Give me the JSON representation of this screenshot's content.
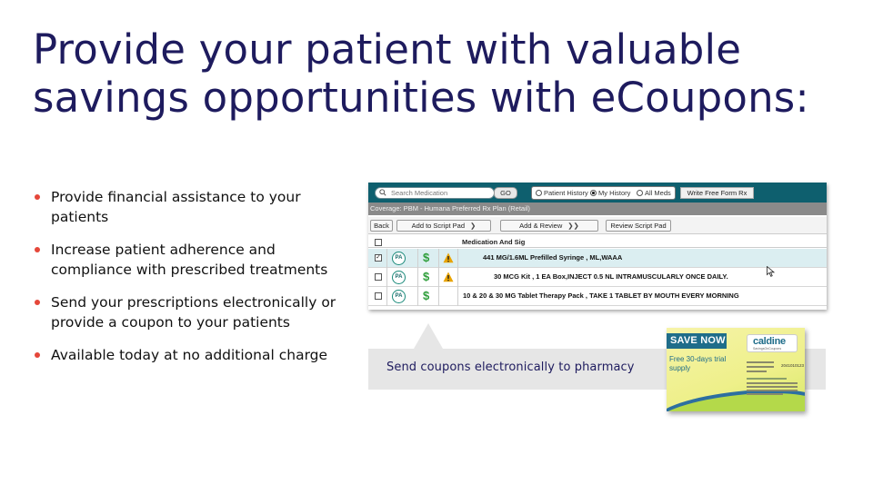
{
  "slide": {
    "title_line1": "Provide your patient with valuable",
    "title_line2": "savings opportunities with eCoupons:",
    "bullets": [
      "Provide financial assistance to your patients",
      "Increase patient adherence and compliance with prescribed treatments",
      "Send your prescriptions electronically or provide a coupon to your patients",
      "Available today at no additional charge"
    ],
    "callout_text": "Send coupons electronically to pharmacy"
  },
  "ehr": {
    "search_placeholder": "Search Medication",
    "go_label": "GO",
    "radios": [
      {
        "label": "Patient History",
        "selected": false
      },
      {
        "label": "My History",
        "selected": true
      },
      {
        "label": "All Meds",
        "selected": false
      }
    ],
    "write_free_form_label": "Write Free Form Rx",
    "coverage_text": "Coverage: PBM - Humana Preferred Rx Plan (Retail)",
    "toolbar": {
      "back_label": "Back",
      "add_script_pad_label": "Add to Script Pad",
      "add_review_label": "Add & Review",
      "review_script_pad_label": "Review Script Pad"
    },
    "table_header": "Medication And Sig",
    "rows": [
      {
        "checked": true,
        "selected": true,
        "icons": [
          "pa-icon",
          "dollar-icon",
          "warning-icon"
        ],
        "sig": "441 MG/1.6ML Prefilled Syringe , ML,WAAA"
      },
      {
        "checked": false,
        "selected": false,
        "icons": [
          "pa-icon",
          "dollar-icon",
          "warning-icon"
        ],
        "sig": "30 MCG Kit , 1 EA Box,INJECT 0.5 NL INTRAMUSCULARLY ONCE DAILY."
      },
      {
        "checked": false,
        "selected": false,
        "icons": [
          "pa-icon",
          "dollar-icon"
        ],
        "sig": "10 & 20 & 30 MG Tablet Therapy Pack , TAKE 1 TABLET BY MOUTH EVERY MORNING"
      }
    ],
    "pa_icon_text": "PA"
  },
  "coupon": {
    "save_now": "SAVE NOW",
    "trial_text": "Free 30-days trial supply",
    "logo_text": "caldine",
    "logo_subtext": "SavingsOnCoupons",
    "id_text": "2041010123"
  },
  "colors": {
    "title": "#1e1b5e",
    "bullet_dot": "#e5473a",
    "ehr_topbar": "#0e5f6e",
    "selected_row": "#dbeef1",
    "coupon_banner": "#1f6d8a"
  }
}
